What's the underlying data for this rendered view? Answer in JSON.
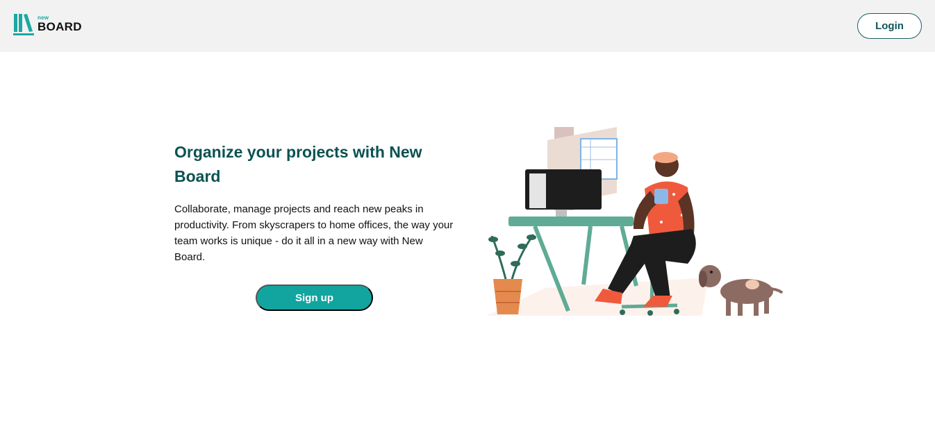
{
  "header": {
    "logo": {
      "small_text": "new",
      "big_text": "BOARD",
      "icon": "books-icon"
    },
    "login_label": "Login"
  },
  "hero": {
    "title": "Organize your projects with New Board",
    "description": "Collaborate, manage projects and reach new peaks in productivity. From skyscrapers to home offices, the way your team works is unique - do it all in a new way with New Board.",
    "signup_label": "Sign up",
    "illustration": "person-at-desk-with-dog-illustration"
  },
  "colors": {
    "accent": "#12a5a0",
    "heading": "#0b5252",
    "header_bg": "#f2f2f2"
  }
}
